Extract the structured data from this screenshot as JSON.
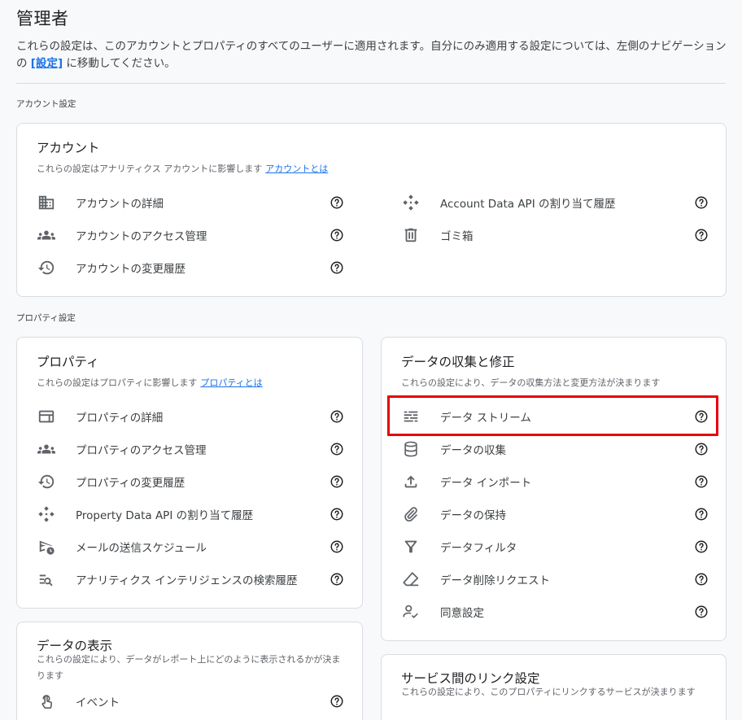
{
  "page": {
    "title": "管理者",
    "intro_before": "これらの設定は、このアカウントとプロパティのすべてのユーザーに適用されます。自分にのみ適用する設定については、左側のナビゲーションの ",
    "intro_link": "[設定]",
    "intro_after": " に移動してください。"
  },
  "sections": {
    "account_label": "アカウント設定",
    "property_label": "プロパティ設定"
  },
  "account_card": {
    "title": "アカウント",
    "desc": "これらの設定はアナリティクス アカウントに影響します",
    "desc_link": "アカウントとは",
    "items": [
      {
        "label": "アカウントの詳細",
        "icon": "building-icon"
      },
      {
        "label": "アカウントのアクセス管理",
        "icon": "people-icon"
      },
      {
        "label": "アカウントの変更履歴",
        "icon": "history-icon"
      },
      {
        "label": "Account Data API の割り当て履歴",
        "icon": "api-icon"
      },
      {
        "label": "ゴミ箱",
        "icon": "trash-icon"
      }
    ]
  },
  "property_card": {
    "title": "プロパティ",
    "desc": "これらの設定はプロパティに影響します",
    "desc_link": "プロパティとは",
    "items": [
      {
        "label": "プロパティの詳細",
        "icon": "web-icon"
      },
      {
        "label": "プロパティのアクセス管理",
        "icon": "people-icon"
      },
      {
        "label": "プロパティの変更履歴",
        "icon": "history-icon"
      },
      {
        "label": "Property Data API の割り当て履歴",
        "icon": "api-icon"
      },
      {
        "label": "メールの送信スケジュール",
        "icon": "schedule-send-icon"
      },
      {
        "label": "アナリティクス インテリジェンスの検索履歴",
        "icon": "search-list-icon"
      }
    ]
  },
  "data_card": {
    "title": "データの収集と修正",
    "desc": "これらの設定により、データの収集方法と変更方法が決まります",
    "items": [
      {
        "label": "データ ストリーム",
        "icon": "stream-icon"
      },
      {
        "label": "データの収集",
        "icon": "database-icon"
      },
      {
        "label": "データ インポート",
        "icon": "upload-icon"
      },
      {
        "label": "データの保持",
        "icon": "attach-icon"
      },
      {
        "label": "データフィルタ",
        "icon": "filter-icon"
      },
      {
        "label": "データ削除リクエスト",
        "icon": "eraser-icon"
      },
      {
        "label": "同意設定",
        "icon": "consent-icon"
      }
    ]
  },
  "display_card": {
    "title": "データの表示",
    "desc": "これらの設定により、データがレポート上にどのように表示されるかが決まります",
    "items": [
      {
        "label": "イベント",
        "icon": "touch-icon"
      }
    ]
  },
  "link_card": {
    "title": "サービス間のリンク設定",
    "desc": "これらの設定により、このプロパティにリンクするサービスが決まります"
  },
  "colors": {
    "accent": "#1a73e8",
    "highlight": "#e8000b",
    "icon": "#5f6368"
  }
}
